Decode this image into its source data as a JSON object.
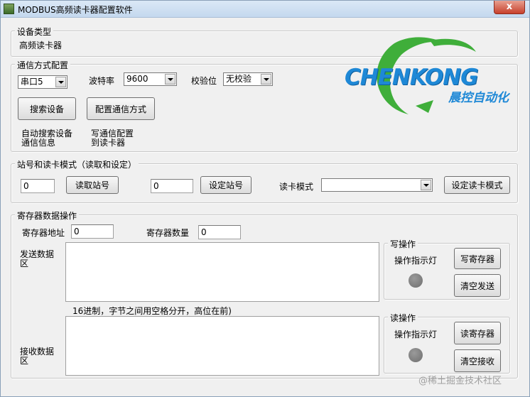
{
  "window": {
    "title": "MODBUS高频读卡器配置软件",
    "close_label": "x"
  },
  "device_type": {
    "label": "设备类型",
    "value": "高频读卡器"
  },
  "comm_config": {
    "label": "通信方式配置",
    "port": {
      "selected": "串口5"
    },
    "baud": {
      "label": "波特率",
      "selected": "9600"
    },
    "parity": {
      "label": "校验位",
      "selected": "无校验"
    },
    "search_button": "搜索设备",
    "config_button": "配置通信方式",
    "search_hint_line1": "自动搜索设备",
    "search_hint_line2": "通信信息",
    "config_hint_line1": "写通信配置",
    "config_hint_line2": "到读卡器"
  },
  "logo": {
    "text": "CHENKONG",
    "subtext": "晨控自动化",
    "colors": {
      "blue": "#1e88d6",
      "green": "#3fae3a"
    }
  },
  "station": {
    "label": "站号和读卡模式（读取和设定）",
    "read_value": "0",
    "read_button": "读取站号",
    "set_value": "0",
    "set_button": "设定站号",
    "mode_label": "读卡模式",
    "mode_selected": "",
    "set_mode_button": "设定读卡模式"
  },
  "register": {
    "label": "寄存器数据操作",
    "address_label": "寄存器地址",
    "address_value": "0",
    "count_label": "寄存器数量",
    "count_value": "0",
    "send_label_line1": "发送数据",
    "send_label_line2": "区",
    "hint": "16进制，字节之间用空格分开，高位在前)",
    "recv_label_line1": "接收数据",
    "recv_label_line2": "区"
  },
  "write_op": {
    "label": "写操作",
    "indicator_label": "操作指示灯",
    "write_button": "写寄存器",
    "clear_button": "清空发送"
  },
  "read_op": {
    "label": "读操作",
    "indicator_label": "操作指示灯",
    "read_button": "读寄存器",
    "clear_button": "清空接收"
  },
  "watermark": "@稀土掘金技术社区"
}
